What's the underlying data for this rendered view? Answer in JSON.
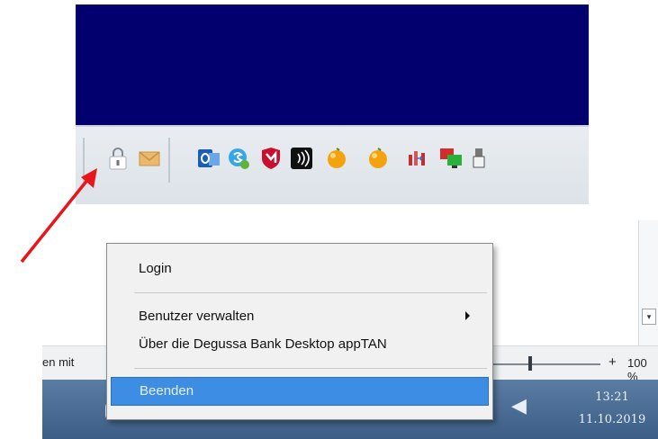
{
  "context_menu": {
    "items": [
      {
        "label": "Login"
      },
      {
        "label": "Benutzer verwalten",
        "has_submenu": true
      },
      {
        "label": "Über die Degussa Bank Desktop appTAN"
      },
      {
        "label": "Beenden",
        "highlighted": true
      }
    ]
  },
  "status_bar": {
    "left_text": "en mit",
    "zoom_plus": "+",
    "zoom_pct": "100 %"
  },
  "scroll_button": {
    "glyph": "▾"
  },
  "taskbar": {
    "tray_chevron": "◀",
    "time": "13:21",
    "date": "11.10.2019"
  },
  "tray_icons": [
    "lock-icon",
    "mail-icon",
    "outlook-icon",
    "skype-icon",
    "mcafee-icon",
    "nfc-reader-icon",
    "orange-ball-icon",
    "orange-ball-icon",
    "network-adapter-icon",
    "display-switch-icon",
    "usb-device-icon"
  ],
  "colors": {
    "desktop_blue": "#02006e",
    "menu_highlight": "#3d8de4",
    "arrow_red": "#e8151b",
    "taskbar_blue": "#4a6c94"
  }
}
